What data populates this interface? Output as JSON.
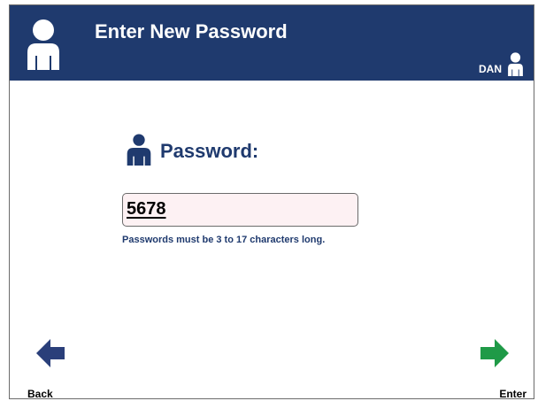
{
  "header": {
    "title": "Enter New Password",
    "icon": "person-icon",
    "user_name": "DAN",
    "user_icon": "person-icon"
  },
  "password": {
    "label": "Password:",
    "value": "5678",
    "hint": "Passwords must be 3 to 17 characters long."
  },
  "nav": {
    "back_label": "Back",
    "enter_label": "Enter"
  },
  "colors": {
    "header_bg": "#1f3a6e",
    "back_arrow": "#2a3f7a",
    "enter_arrow": "#1f9a47",
    "field_bg": "#fdf1f3"
  }
}
